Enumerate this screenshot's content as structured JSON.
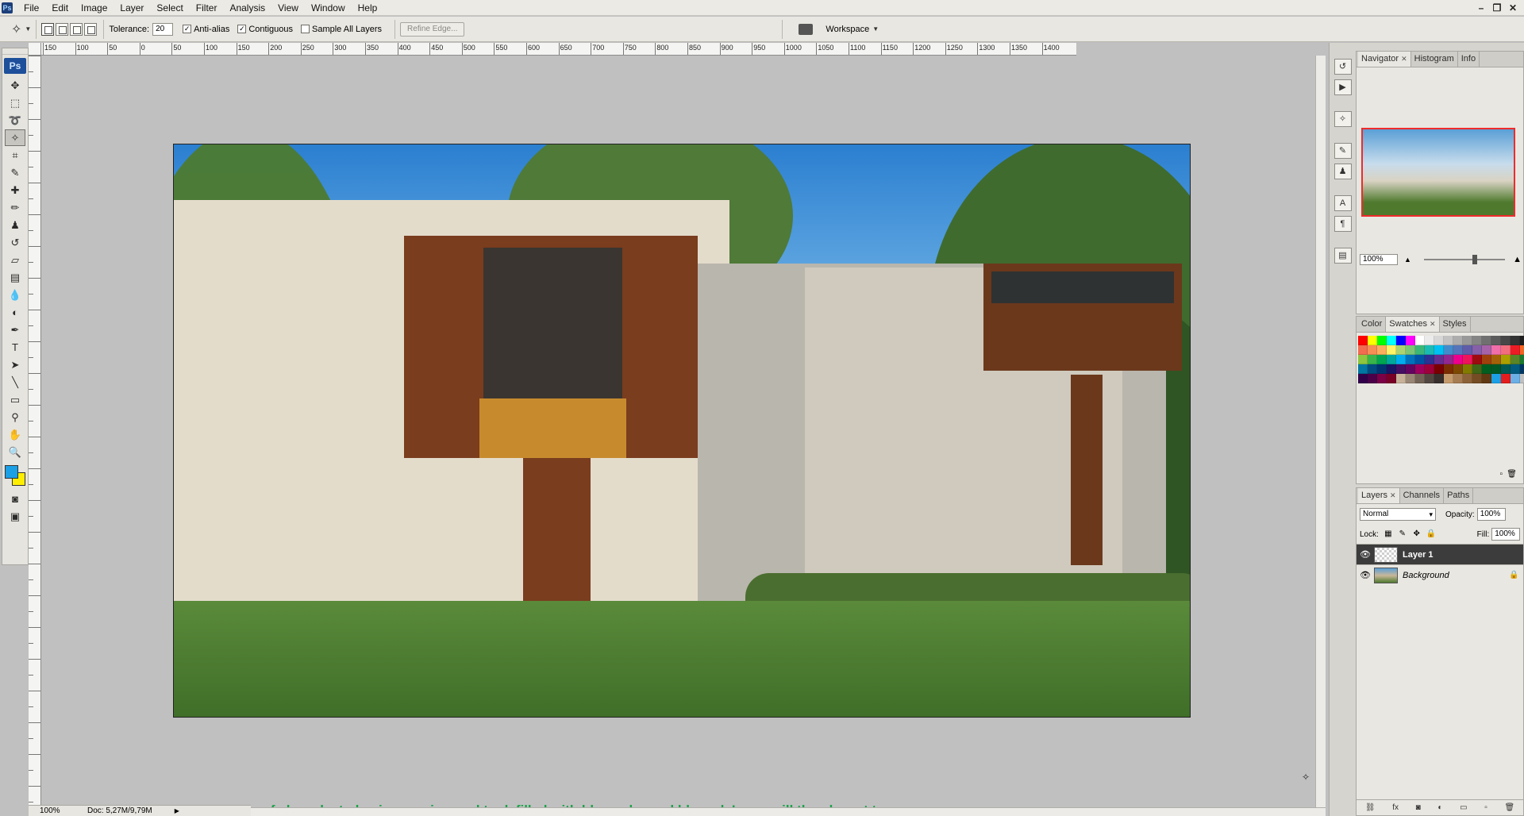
{
  "menubar": {
    "app_badge": "Ps",
    "items": [
      "File",
      "Edit",
      "Image",
      "Layer",
      "Select",
      "Filter",
      "Analysis",
      "View",
      "Window",
      "Help"
    ],
    "window_controls": [
      "–",
      "❐",
      "✕"
    ]
  },
  "options": {
    "tolerance_label": "Tolerance:",
    "tolerance_value": "20",
    "anti_alias_label": "Anti-alias",
    "anti_alias_checked": true,
    "contiguous_label": "Contiguous",
    "contiguous_checked": true,
    "sample_all_label": "Sample All Layers",
    "sample_all_checked": false,
    "refine_edge_label": "Refine Edge...",
    "workspace_label": "Workspace"
  },
  "toolbox": {
    "logo": "Ps",
    "foreground_color": "#1ba0e6",
    "background_color": "#ffee00"
  },
  "ruler": {
    "top_labels": [
      "150",
      "100",
      "50",
      "0",
      "50",
      "100",
      "150",
      "200",
      "250",
      "300",
      "350",
      "400",
      "450",
      "500",
      "550",
      "600",
      "650",
      "700",
      "750",
      "800",
      "850",
      "900",
      "950",
      "1000",
      "1050",
      "1100",
      "1150",
      "1200",
      "1250",
      "1300",
      "1350",
      "1400"
    ]
  },
  "canvas": {
    "caption": "Area of sky selected using magic wand tool, filled with blue color and blurred. Layer will then be set to screen."
  },
  "status": {
    "zoom": "100%",
    "doc_info": "Doc: 5,27M/9,79M"
  },
  "navigator": {
    "tabs": [
      "Navigator",
      "Histogram",
      "Info"
    ],
    "zoom": "100%"
  },
  "color_panel": {
    "tabs": [
      "Color",
      "Swatches",
      "Styles"
    ]
  },
  "layers_panel": {
    "tabs": [
      "Layers",
      "Channels",
      "Paths"
    ],
    "blend_mode": "Normal",
    "opacity_label": "Opacity:",
    "opacity_value": "100%",
    "lock_label": "Lock:",
    "fill_label": "Fill:",
    "fill_value": "100%",
    "layers": [
      {
        "name": "Layer 1",
        "selected": true
      },
      {
        "name": "Background",
        "selected": false
      }
    ]
  }
}
